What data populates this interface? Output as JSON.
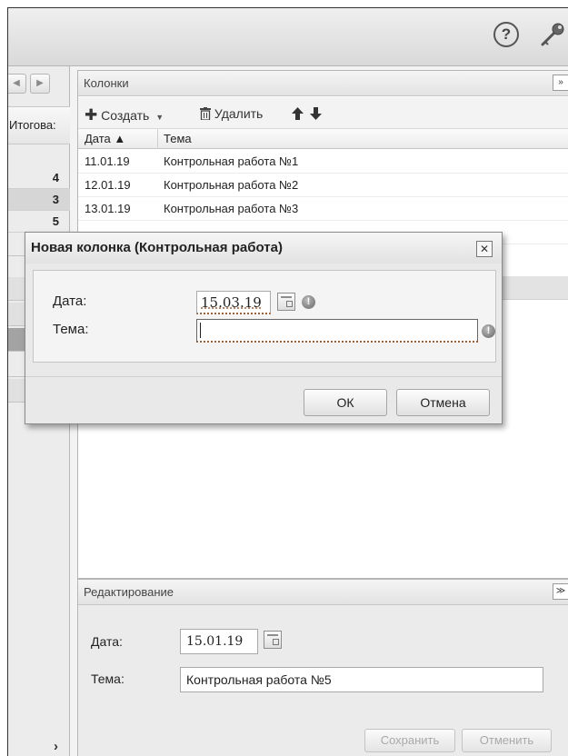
{
  "columns_panel": {
    "title": "Колонки",
    "toolbar": {
      "create_label": "Создать",
      "delete_label": "Удалить"
    },
    "headers": {
      "date": "Дата ▲",
      "topic": "Тема"
    },
    "rows": [
      {
        "date": "11.01.19",
        "topic": "Контрольная работа №1"
      },
      {
        "date": "12.01.19",
        "topic": "Контрольная работа №2"
      },
      {
        "date": "13.01.19",
        "topic": "Контрольная работа №3"
      }
    ]
  },
  "left_pane": {
    "header": "Итогова:",
    "grades": [
      "4",
      "3",
      "5"
    ]
  },
  "edit_panel": {
    "title": "Редактирование",
    "date_label": "Дата:",
    "date_value": "15.01.19",
    "topic_label": "Тема:",
    "topic_value": "Контрольная работа №5",
    "save_label": "Сохранить",
    "cancel_label": "Отменить"
  },
  "dialog": {
    "title": "Новая колонка (Контрольная работа)",
    "date_label": "Дата:",
    "date_value": "15.03.19",
    "topic_label": "Тема:",
    "topic_value": "",
    "ok_label": "ОК",
    "cancel_label": "Отмена"
  }
}
